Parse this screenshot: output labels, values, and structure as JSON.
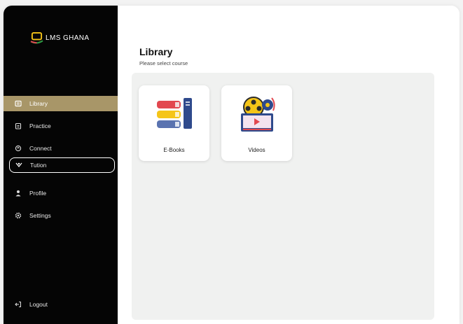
{
  "app": {
    "logo_text": "LMS GHANA"
  },
  "sidebar": {
    "items": [
      {
        "label": "Library",
        "icon": "book-icon",
        "state": "active"
      },
      {
        "label": "Practice",
        "icon": "clipboard-icon",
        "state": "normal"
      },
      {
        "label": "Connect",
        "icon": "connect-icon",
        "state": "normal"
      },
      {
        "label": "Tution",
        "icon": "tuition-icon",
        "state": "outlined"
      },
      {
        "label": "Profile",
        "icon": "person-icon",
        "state": "normal"
      },
      {
        "label": "Settings",
        "icon": "gear-icon",
        "state": "normal"
      }
    ],
    "logout_label": "Logout"
  },
  "main": {
    "title": "Library",
    "subtitle": "Please select course",
    "cards": [
      {
        "label": "E-Books",
        "icon": "books-icon"
      },
      {
        "label": "Videos",
        "icon": "video-reel-icon"
      }
    ]
  },
  "colors": {
    "sidebar_bg": "#050505",
    "active_item": "#a89668",
    "panel_bg": "#f0f1f0",
    "book_red": "#e2474f",
    "book_yellow": "#f5c518",
    "book_blue": "#2f4a8c"
  }
}
